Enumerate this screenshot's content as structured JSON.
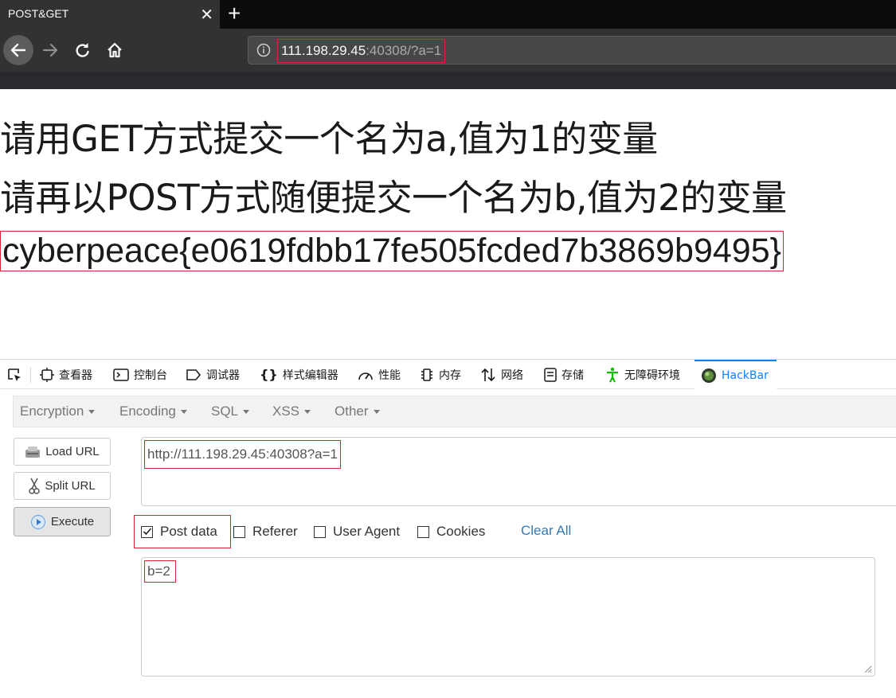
{
  "browser": {
    "tab_title": "POST&GET",
    "tab_close": "✕",
    "new_tab": "+",
    "url_host": "111.198.29.45",
    "url_rest": ":40308/?a=1"
  },
  "page": {
    "line1": "请用GET方式提交一个名为a,值为1的变量",
    "line2": "请再以POST方式随便提交一个名为b,值为2的变量",
    "flag": "cyberpeace{e0619fdbb17fe505fcded7b3869b9495}"
  },
  "devtools": {
    "tabs": [
      "查看器",
      "控制台",
      "调试器",
      "样式编辑器",
      "性能",
      "内存",
      "网络",
      "存储",
      "无障碍环境",
      "HackBar"
    ],
    "active_tab": "HackBar"
  },
  "hackbar": {
    "menu": [
      "Encryption",
      "Encoding",
      "SQL",
      "XSS",
      "Other"
    ],
    "buttons": {
      "load": "Load URL",
      "split": "Split URL",
      "execute": "Execute"
    },
    "url_value": "http://111.198.29.45:40308?a=1",
    "options": {
      "post_data": "Post data",
      "referer": "Referer",
      "user_agent": "User Agent",
      "cookies": "Cookies",
      "clear_all": "Clear All"
    },
    "post_checked": true,
    "post_value": "b=2"
  },
  "colors": {
    "highlight": "#e0212f",
    "active_tab": "#0a84ff",
    "link": "#337ab7"
  }
}
